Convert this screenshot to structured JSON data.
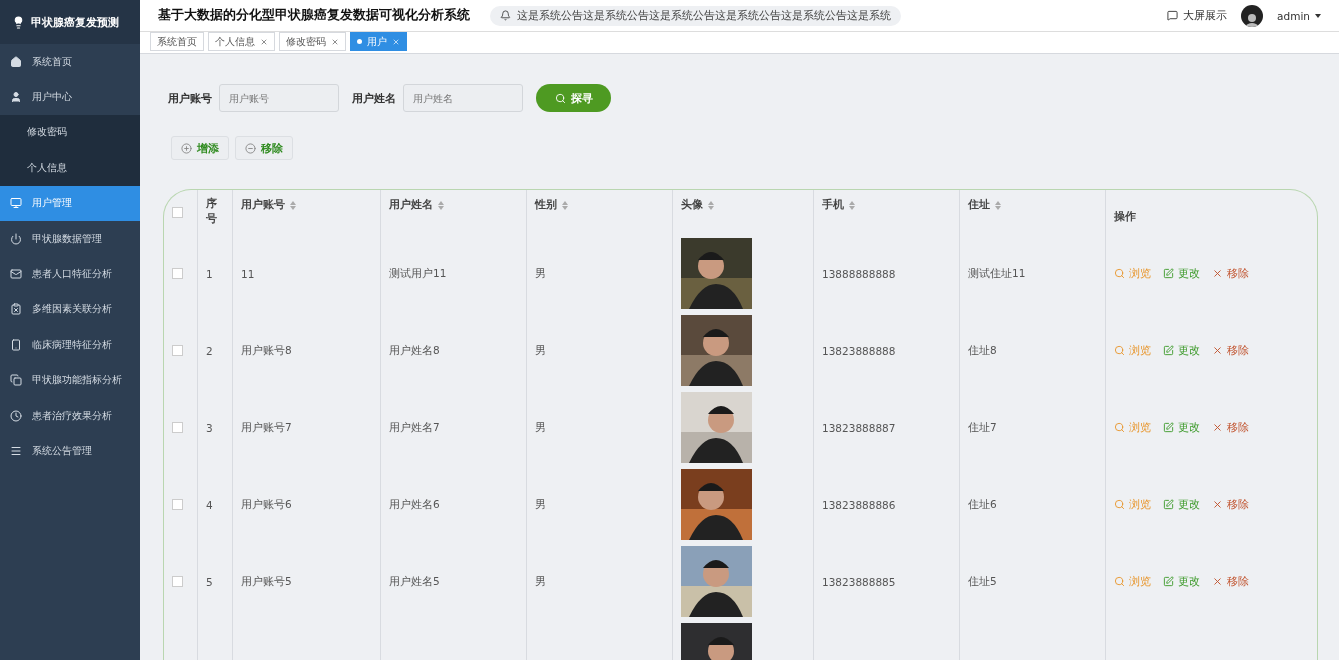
{
  "sidebar": {
    "title": "甲状腺癌复发预测",
    "items": [
      {
        "label": "系统首页",
        "selected": false
      },
      {
        "label": "用户中心",
        "selected": false,
        "children": [
          {
            "label": "修改密码",
            "selected": false
          },
          {
            "label": "个人信息",
            "selected": false
          }
        ]
      },
      {
        "label": "用户管理",
        "selected": true
      },
      {
        "label": "甲状腺数据管理",
        "selected": false
      },
      {
        "label": "患者人口特征分析",
        "selected": false
      },
      {
        "label": "多维因素关联分析",
        "selected": false
      },
      {
        "label": "临床病理特征分析",
        "selected": false
      },
      {
        "label": "甲状腺功能指标分析",
        "selected": false
      },
      {
        "label": "患者治疗效果分析",
        "selected": false
      },
      {
        "label": "系统公告管理",
        "selected": false
      }
    ]
  },
  "header": {
    "title": "基于大数据的分化型甲状腺癌复发数据可视化分析系统",
    "notice": "这是系统公告这是系统公告这是系统公告这是系统公告这是系统公告这是系统",
    "screen_link": "大屏展示",
    "user": "admin"
  },
  "tabs": [
    {
      "label": "系统首页",
      "selected": false,
      "closable": false
    },
    {
      "label": "个人信息",
      "selected": false,
      "closable": true
    },
    {
      "label": "修改密码",
      "selected": false,
      "closable": true
    },
    {
      "label": "用户",
      "selected": true,
      "closable": true
    }
  ],
  "search": {
    "fields": [
      {
        "label": "用户账号",
        "placeholder": "用户账号"
      },
      {
        "label": "用户姓名",
        "placeholder": "用户姓名"
      }
    ],
    "button": "探寻"
  },
  "actions": [
    {
      "kind": "add",
      "label": "增添"
    },
    {
      "kind": "remove",
      "label": "移除"
    }
  ],
  "table": {
    "all_checked": false,
    "columns": [
      {
        "label": "序号",
        "sortable": false
      },
      {
        "label": "用户账号",
        "sortable": true
      },
      {
        "label": "用户姓名",
        "sortable": true
      },
      {
        "label": "性别",
        "sortable": true
      },
      {
        "label": "头像",
        "sortable": true
      },
      {
        "label": "手机",
        "sortable": true
      },
      {
        "label": "住址",
        "sortable": true
      },
      {
        "label": "操作",
        "sortable": false
      }
    ],
    "rows": [
      {
        "checked": false,
        "index": "1",
        "account": "11",
        "name": "测试用户11",
        "gender": "男",
        "phone": "13888888888",
        "address": "测试住址11",
        "buttons": [
          {
            "kind": "view",
            "label": "浏览"
          },
          {
            "kind": "edit",
            "label": "更改"
          },
          {
            "kind": "delete",
            "label": "移除"
          }
        ]
      },
      {
        "checked": false,
        "index": "2",
        "account": "用户账号8",
        "name": "用户姓名8",
        "gender": "男",
        "phone": "13823888888",
        "address": "住址8",
        "buttons": [
          {
            "kind": "view",
            "label": "浏览"
          },
          {
            "kind": "edit",
            "label": "更改"
          },
          {
            "kind": "delete",
            "label": "移除"
          }
        ]
      },
      {
        "checked": false,
        "index": "3",
        "account": "用户账号7",
        "name": "用户姓名7",
        "gender": "男",
        "phone": "13823888887",
        "address": "住址7",
        "buttons": [
          {
            "kind": "view",
            "label": "浏览"
          },
          {
            "kind": "edit",
            "label": "更改"
          },
          {
            "kind": "delete",
            "label": "移除"
          }
        ]
      },
      {
        "checked": false,
        "index": "4",
        "account": "用户账号6",
        "name": "用户姓名6",
        "gender": "男",
        "phone": "13823888886",
        "address": "住址6",
        "buttons": [
          {
            "kind": "view",
            "label": "浏览"
          },
          {
            "kind": "edit",
            "label": "更改"
          },
          {
            "kind": "delete",
            "label": "移除"
          }
        ]
      },
      {
        "checked": false,
        "index": "5",
        "account": "用户账号5",
        "name": "用户姓名5",
        "gender": "男",
        "phone": "13823888885",
        "address": "住址5",
        "buttons": [
          {
            "kind": "view",
            "label": "浏览"
          },
          {
            "kind": "edit",
            "label": "更改"
          },
          {
            "kind": "delete",
            "label": "移除"
          }
        ]
      },
      {
        "kind": "partial"
      }
    ]
  }
}
